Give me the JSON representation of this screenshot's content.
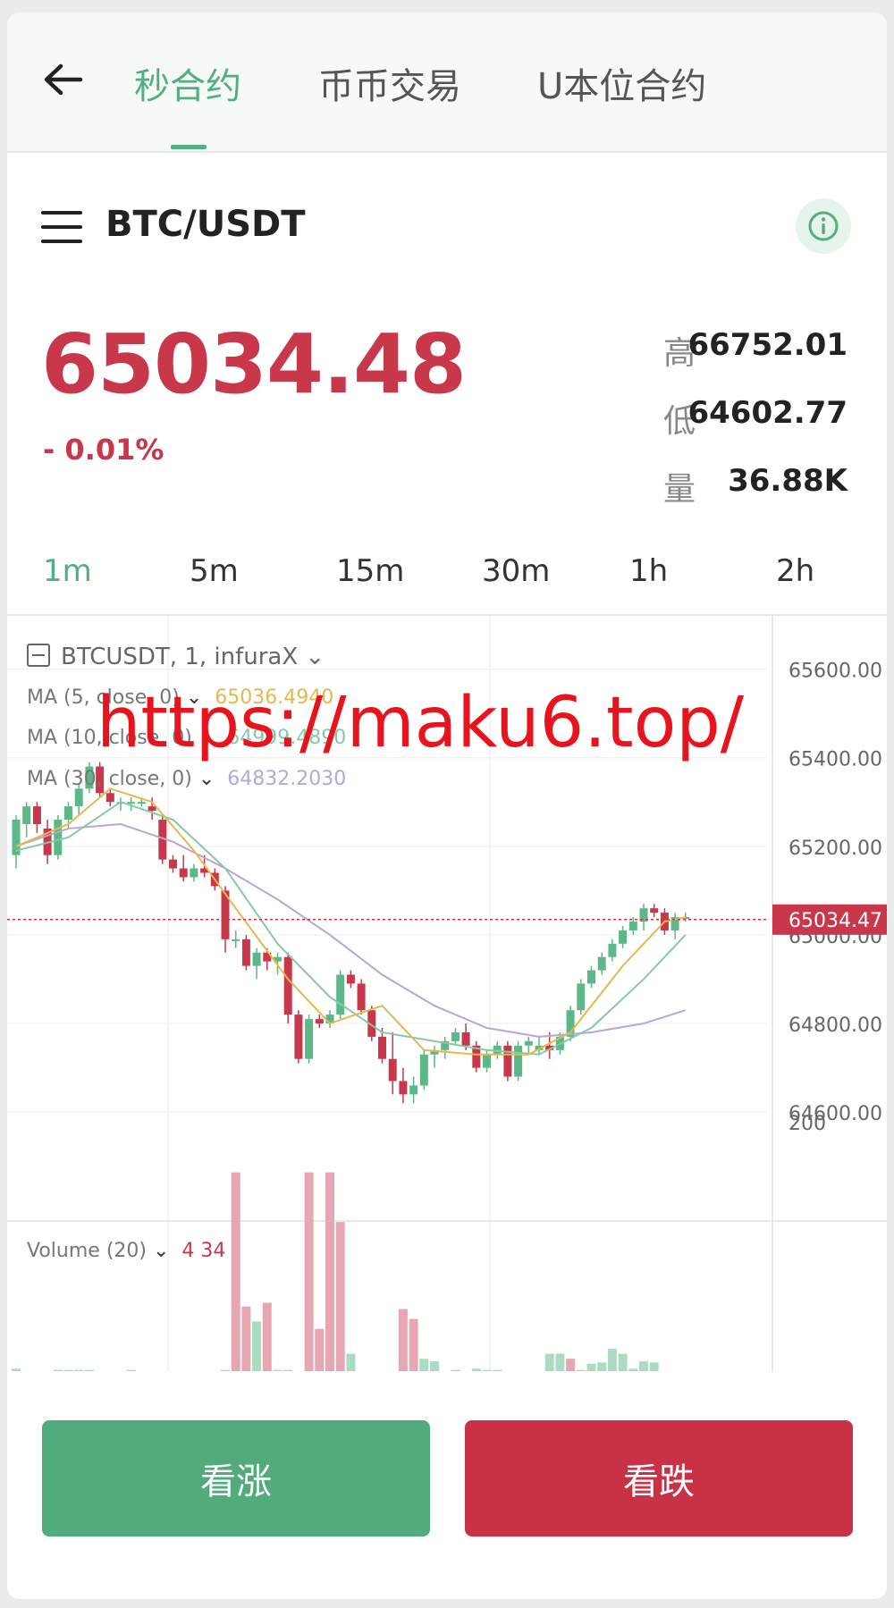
{
  "nav": {
    "tabs": [
      {
        "label": "秒合约",
        "active": true
      },
      {
        "label": "币币交易",
        "active": false
      },
      {
        "label": "U本位合约",
        "active": false
      }
    ]
  },
  "pair": {
    "name": "BTC/USDT"
  },
  "ticker": {
    "price": "65034.48",
    "change": "- 0.01%",
    "high_label": "高",
    "high": "66752.01",
    "low_label": "低",
    "low": "64602.77",
    "vol_label": "量",
    "volume": "36.88K"
  },
  "timeframes": [
    {
      "label": "1m",
      "active": true
    },
    {
      "label": "5m",
      "active": false
    },
    {
      "label": "15m",
      "active": false
    },
    {
      "label": "30m",
      "active": false
    },
    {
      "label": "1h",
      "active": false
    },
    {
      "label": "2h",
      "active": false
    }
  ],
  "chart": {
    "symbol_label": "BTCUSDT, 1, infuraX",
    "ma": [
      {
        "label": "MA (5, close, 0)",
        "value": "65036.4940",
        "color": "#e5b84e"
      },
      {
        "label": "MA (10, close, 0)",
        "value": "64999.4890",
        "color": "#86c9a8"
      },
      {
        "label": "MA (30, close, 0)",
        "value": "64832.2030",
        "color": "#b7a6d8"
      }
    ],
    "volume_label": "Volume (20)",
    "volume_values": "4 34",
    "current_price_tag": "65034.47",
    "watermark": "https://maku6.top/"
  },
  "chart_data": {
    "type": "candlestick",
    "y_ticks": [
      "65600.00",
      "65400.00",
      "65200.00",
      "65000.00",
      "64800.00",
      "64600.00"
    ],
    "ylim": [
      64560,
      65720
    ],
    "volume_ticks": [
      "200"
    ],
    "up_color": "#5db887",
    "down_color": "#c8374a",
    "candles": [
      [
        65180,
        65270,
        65150,
        65260
      ],
      [
        65250,
        65300,
        65220,
        65290
      ],
      [
        65290,
        65300,
        65230,
        65250
      ],
      [
        65240,
        65260,
        65160,
        65180
      ],
      [
        65180,
        65270,
        65170,
        65260
      ],
      [
        65260,
        65300,
        65240,
        65290
      ],
      [
        65290,
        65340,
        65270,
        65330
      ],
      [
        65330,
        65390,
        65320,
        65380
      ],
      [
        65380,
        65390,
        65310,
        65320
      ],
      [
        65320,
        65330,
        65290,
        65300
      ],
      [
        65300,
        65310,
        65280,
        65300
      ],
      [
        65300,
        65310,
        65280,
        65300
      ],
      [
        65300,
        65310,
        65290,
        65300
      ],
      [
        65290,
        65310,
        65260,
        65280
      ],
      [
        65260,
        65270,
        65160,
        65170
      ],
      [
        65170,
        65180,
        65140,
        65150
      ],
      [
        65150,
        65180,
        65120,
        65130
      ],
      [
        65130,
        65160,
        65120,
        65150
      ],
      [
        65150,
        65180,
        65130,
        65140
      ],
      [
        65140,
        65150,
        65100,
        65110
      ],
      [
        65100,
        65110,
        64960,
        64990
      ],
      [
        64990,
        65010,
        64970,
        64990
      ],
      [
        64990,
        65000,
        64920,
        64930
      ],
      [
        64930,
        64970,
        64900,
        64960
      ],
      [
        64960,
        64970,
        64920,
        64940
      ],
      [
        64940,
        64960,
        64910,
        64950
      ],
      [
        64950,
        64960,
        64800,
        64820
      ],
      [
        64820,
        64830,
        64710,
        64720
      ],
      [
        64720,
        64820,
        64710,
        64810
      ],
      [
        64810,
        64820,
        64790,
        64800
      ],
      [
        64800,
        64830,
        64790,
        64820
      ],
      [
        64820,
        64920,
        64810,
        64910
      ],
      [
        64910,
        64920,
        64880,
        64890
      ],
      [
        64890,
        64900,
        64820,
        64830
      ],
      [
        64830,
        64840,
        64760,
        64770
      ],
      [
        64770,
        64790,
        64710,
        64720
      ],
      [
        64720,
        64780,
        64640,
        64670
      ],
      [
        64670,
        64700,
        64620,
        64640
      ],
      [
        64640,
        64680,
        64620,
        64660
      ],
      [
        64660,
        64740,
        64650,
        64730
      ],
      [
        64730,
        64750,
        64700,
        64740
      ],
      [
        64740,
        64770,
        64720,
        64760
      ],
      [
        64760,
        64790,
        64750,
        64780
      ],
      [
        64780,
        64800,
        64740,
        64750
      ],
      [
        64750,
        64760,
        64690,
        64700
      ],
      [
        64700,
        64740,
        64690,
        64730
      ],
      [
        64730,
        64760,
        64720,
        64750
      ],
      [
        64750,
        64760,
        64670,
        64680
      ],
      [
        64680,
        64760,
        64670,
        64750
      ],
      [
        64750,
        64770,
        64730,
        64760
      ],
      [
        64740,
        64770,
        64730,
        64750
      ],
      [
        64750,
        64780,
        64720,
        64740
      ],
      [
        64740,
        64780,
        64730,
        64770
      ],
      [
        64770,
        64840,
        64760,
        64830
      ],
      [
        64830,
        64900,
        64820,
        64890
      ],
      [
        64890,
        64930,
        64880,
        64920
      ],
      [
        64920,
        64960,
        64910,
        64950
      ],
      [
        64950,
        64990,
        64940,
        64980
      ],
      [
        64980,
        65020,
        64970,
        65010
      ],
      [
        65010,
        65040,
        65000,
        65030
      ],
      [
        65030,
        65070,
        65010,
        65060
      ],
      [
        65060,
        65070,
        65040,
        65050
      ],
      [
        65050,
        65060,
        65000,
        65010
      ],
      [
        65010,
        65050,
        64990,
        65040
      ],
      [
        65040,
        65050,
        65030,
        65040
      ]
    ],
    "ma5": [
      [
        0,
        65200
      ],
      [
        5,
        65250
      ],
      [
        9,
        65330
      ],
      [
        13,
        65300
      ],
      [
        17,
        65190
      ],
      [
        21,
        65060
      ],
      [
        26,
        64900
      ],
      [
        30,
        64800
      ],
      [
        35,
        64840
      ],
      [
        39,
        64740
      ],
      [
        44,
        64730
      ],
      [
        49,
        64730
      ],
      [
        53,
        64780
      ],
      [
        58,
        64930
      ],
      [
        62,
        65030
      ],
      [
        64,
        65040
      ]
    ],
    "ma10": [
      [
        0,
        65190
      ],
      [
        5,
        65220
      ],
      [
        10,
        65300
      ],
      [
        15,
        65260
      ],
      [
        20,
        65150
      ],
      [
        25,
        64980
      ],
      [
        30,
        64860
      ],
      [
        35,
        64780
      ],
      [
        40,
        64760
      ],
      [
        45,
        64740
      ],
      [
        50,
        64730
      ],
      [
        55,
        64790
      ],
      [
        60,
        64900
      ],
      [
        64,
        65000
      ]
    ],
    "ma30": [
      [
        0,
        65200
      ],
      [
        5,
        65240
      ],
      [
        10,
        65250
      ],
      [
        15,
        65210
      ],
      [
        20,
        65150
      ],
      [
        25,
        65080
      ],
      [
        30,
        65000
      ],
      [
        35,
        64910
      ],
      [
        40,
        64840
      ],
      [
        45,
        64790
      ],
      [
        50,
        64770
      ],
      [
        55,
        64780
      ],
      [
        60,
        64800
      ],
      [
        64,
        64830
      ]
    ],
    "volumes": [
      2,
      0,
      0,
      0,
      1,
      1,
      1,
      1,
      0,
      0,
      0,
      1,
      0,
      0,
      0,
      0,
      0,
      0,
      0,
      0,
      1,
      160,
      52,
      40,
      55,
      1,
      1,
      0,
      160,
      34,
      160,
      120,
      14,
      0,
      0,
      0,
      0,
      50,
      42,
      10,
      8,
      0,
      1,
      0,
      2,
      1,
      1,
      0,
      0,
      0,
      0,
      14,
      14,
      10,
      1,
      6,
      7,
      18,
      14,
      2,
      8,
      7,
      0,
      0,
      0
    ],
    "volume_up": [
      true,
      true,
      true,
      true,
      true,
      true,
      true,
      true,
      true,
      true,
      true,
      true,
      true,
      true,
      true,
      true,
      true,
      true,
      true,
      true,
      true,
      false,
      false,
      true,
      false,
      true,
      true,
      true,
      false,
      false,
      false,
      false,
      true,
      true,
      true,
      true,
      true,
      false,
      false,
      true,
      true,
      true,
      true,
      true,
      true,
      true,
      true,
      true,
      true,
      true,
      true,
      true,
      true,
      false,
      true,
      true,
      true,
      true,
      true,
      true,
      true,
      true,
      true,
      true,
      true
    ]
  },
  "actions": {
    "buy_label": "看涨",
    "sell_label": "看跌"
  }
}
